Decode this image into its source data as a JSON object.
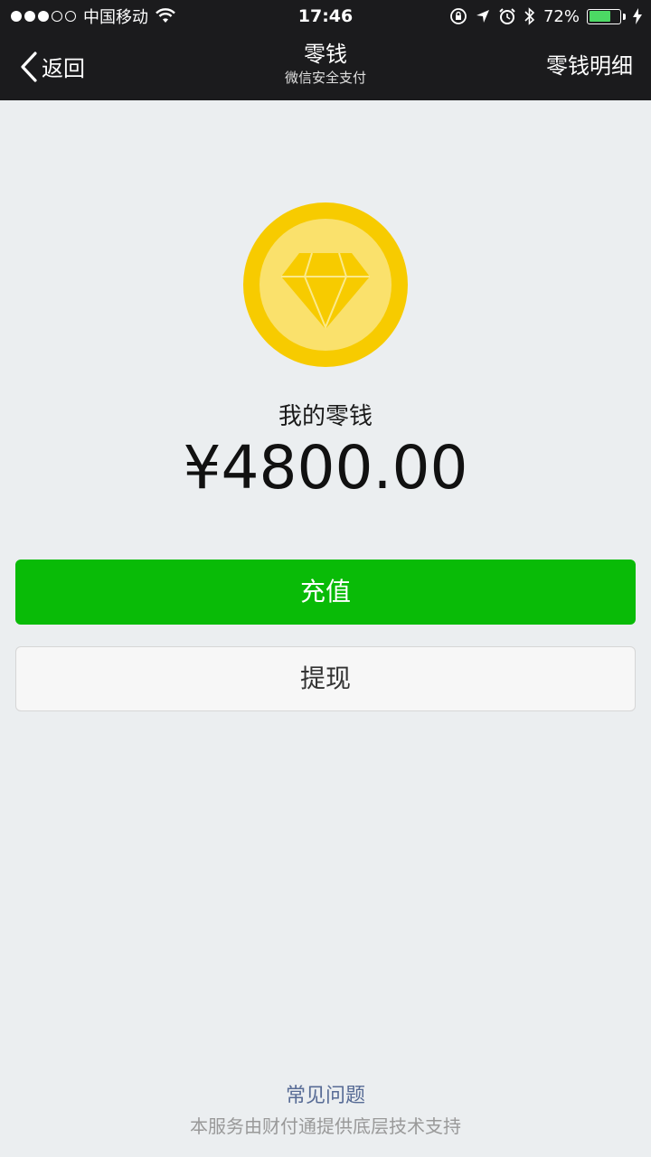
{
  "status_bar": {
    "carrier": "中国移动",
    "time": "17:46",
    "battery_percent_label": "72%",
    "battery_level": 0.72
  },
  "nav": {
    "back_label": "返回",
    "title": "零钱",
    "subtitle": "微信安全支付",
    "right_action": "零钱明细"
  },
  "balance": {
    "label": "我的零钱",
    "amount": "¥4800.00"
  },
  "actions": {
    "recharge_label": "充值",
    "withdraw_label": "提现"
  },
  "footer": {
    "faq_label": "常见问题",
    "note": "本服务由财付通提供底层技术支持"
  },
  "icons": {
    "coin": "diamond-coin-icon",
    "back": "chevron-left-icon"
  },
  "colors": {
    "nav_bg": "#1b1b1d",
    "recharge_green": "#09bb07",
    "coin_outer": "#f7cb00",
    "coin_inner": "#fae16c",
    "link_blue": "#576b95"
  }
}
